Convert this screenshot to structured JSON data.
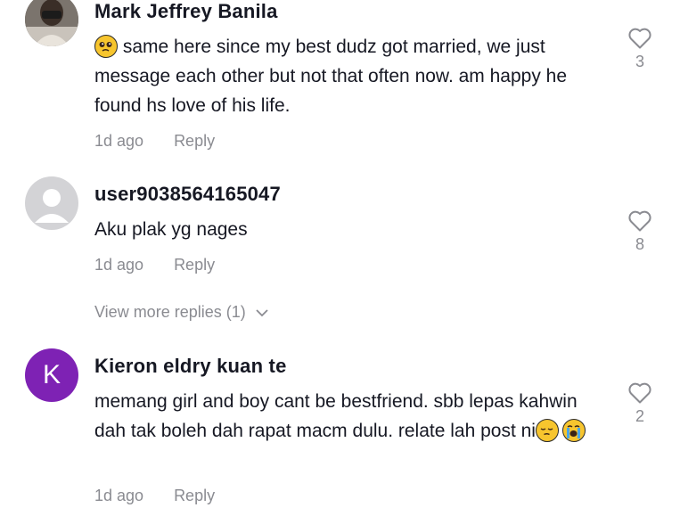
{
  "comments": [
    {
      "username": "Mark Jeffrey Banila",
      "avatar": "user-photo",
      "emoji": "pleading-face",
      "text": "same here since my best dudz got married, we just message each other but not that often now. am happy he found hs love of his life.",
      "time": "1d ago",
      "reply_label": "Reply",
      "likes": "3"
    },
    {
      "username": "user9038564165047",
      "avatar": "default-avatar",
      "text": "Aku plak yg nages",
      "time": "1d ago",
      "reply_label": "Reply",
      "likes": "8",
      "view_more": "View more replies (1)"
    },
    {
      "username": "Kieron eldry kuan te",
      "avatar_letter": "K",
      "avatar_color": "#7e22b4",
      "text": "memang girl and boy cant be bestfriend. sbb lepas kahwin dah tak boleh dah rapat macm dulu. relate lah post ni",
      "emojis": [
        "pensive-face",
        "loudly-crying-face"
      ],
      "time": "1d ago",
      "reply_label": "Reply",
      "likes": "2"
    }
  ]
}
